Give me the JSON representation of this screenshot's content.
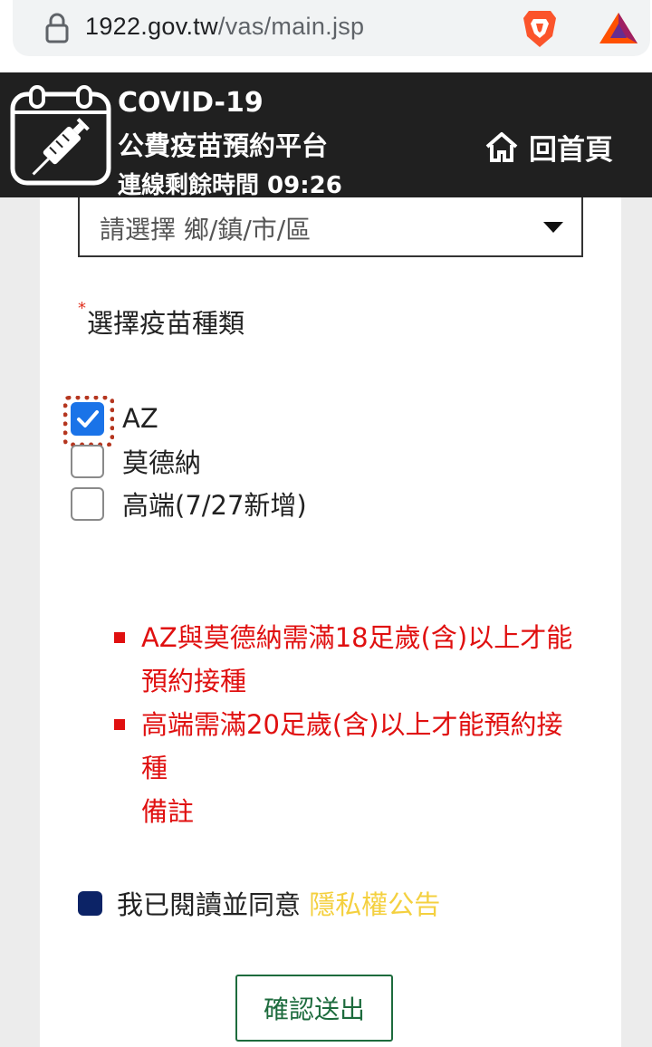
{
  "browser": {
    "url_host": "1922.gov.tw",
    "url_path": "/vas/main.jsp"
  },
  "header": {
    "title_line1": "COVID-19",
    "title_line2": "公費疫苗預約平台",
    "session_label": "連線剩餘時間 09:26",
    "home_label": "回首頁"
  },
  "form": {
    "district_placeholder": "請選擇 鄉/鎮/市/區",
    "required_mark": "*",
    "vaccine_label": "選擇疫苗種類",
    "vaccines": [
      {
        "label": "AZ",
        "checked": true
      },
      {
        "label": "莫德納",
        "checked": false
      },
      {
        "label": "高端(7/27新增)",
        "checked": false
      }
    ],
    "notes": [
      "AZ與莫德納需滿18足歲(含)以上才能預約接種",
      "高端需滿20足歲(含)以上才能預約接種"
    ],
    "notes_remark": "備註",
    "agree_text": "我已閱讀並同意",
    "privacy_link": "隱私權公告",
    "submit_label": "確認送出"
  },
  "colors": {
    "header_bg": "#202020",
    "checkbox_checked": "#1a73e8",
    "note_red": "#e01010",
    "privacy_link": "#f4d03f",
    "submit_green": "#1d6b3d",
    "agree_box": "#0c2366"
  }
}
